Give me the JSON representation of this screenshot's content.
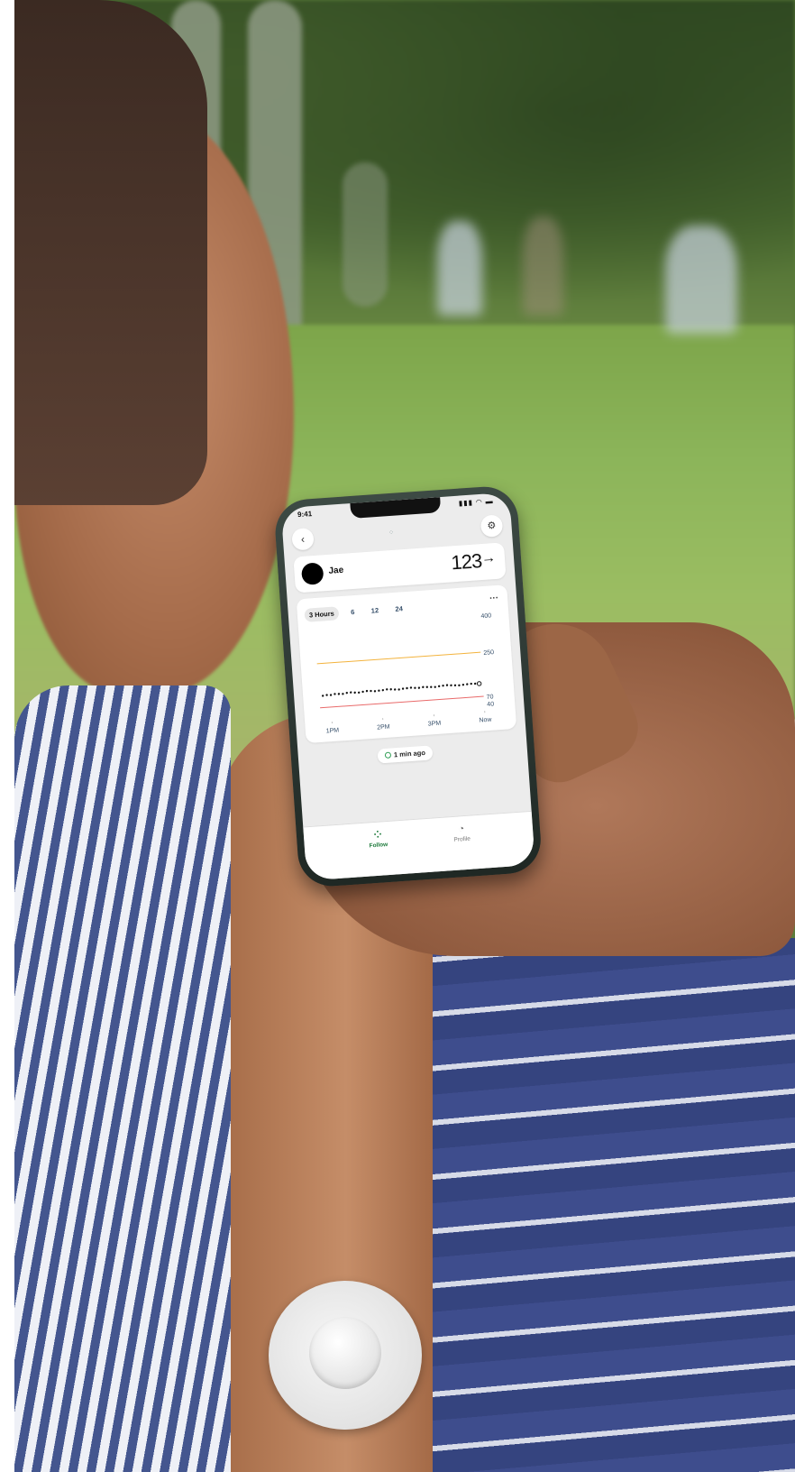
{
  "status_bar": {
    "time": "9:41",
    "icons": "▮▮▮ ◠ ▬"
  },
  "nav": {
    "back_icon": "‹",
    "logo_glyph": "⁘",
    "settings_icon": "⚙"
  },
  "glucose_card": {
    "name": "Jae",
    "value": "123",
    "trend": "→"
  },
  "chart": {
    "range_tabs": [
      "3 Hours",
      "6",
      "12",
      "24"
    ],
    "active_range": "3 Hours",
    "more_label": "···"
  },
  "chart_data": {
    "type": "scatter",
    "x": [
      "1PM",
      "2PM",
      "3PM",
      "Now"
    ],
    "y_tick_labels": [
      "400",
      "250",
      "70",
      "40"
    ],
    "ylim": [
      40,
      400
    ],
    "high_threshold": 250,
    "low_threshold": 70,
    "high_threshold_color": "#f3b33d",
    "low_threshold_color": "#e96a6a",
    "series": [
      {
        "values": [
          118,
          120,
          119,
          122,
          121,
          120,
          123,
          124,
          122,
          121,
          123,
          125,
          124,
          122,
          123,
          124,
          126,
          125,
          123,
          122,
          124,
          125,
          126,
          124,
          123,
          125,
          124,
          123,
          122,
          124,
          125,
          126,
          124,
          123,
          122,
          123,
          124,
          125,
          124,
          123
        ]
      }
    ]
  },
  "last_updated": "1 min ago",
  "tabs": [
    {
      "label": "Follow",
      "icon": "⁘"
    },
    {
      "label": "Profile",
      "icon": "◔"
    }
  ],
  "colors": {
    "accent": "#1d7a3b",
    "screen_bg": "#ececec"
  }
}
